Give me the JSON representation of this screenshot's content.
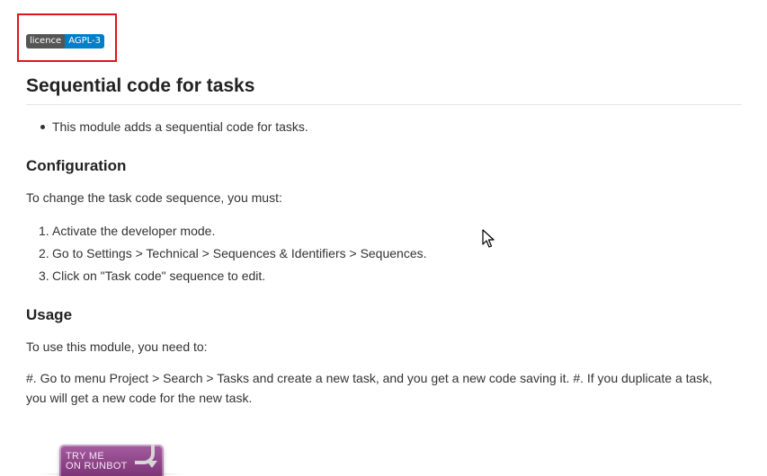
{
  "badge": {
    "left_label": "licence",
    "right_label": "AGPL-3",
    "left_color": "#555555",
    "right_color": "#007ec6"
  },
  "highlight_color": "#e0141c",
  "title": "Sequential code for tasks",
  "intro_bullets": [
    "This module adds a sequential code for tasks."
  ],
  "configuration": {
    "heading": "Configuration",
    "intro": "To change the task code sequence, you must:",
    "steps": [
      {
        "num": "1.",
        "text": "Activate the developer mode."
      },
      {
        "num": "2.",
        "text": "Go to Settings > Technical > Sequences & Identifiers > Sequences."
      },
      {
        "num": "3.",
        "text": "Click on \"Task code\" sequence to edit."
      }
    ]
  },
  "usage": {
    "heading": "Usage",
    "intro": "To use this module, you need to:",
    "body_line1": "#. Go to menu Project > Search > Tasks and create a new task, and you get a new code saving it. #. If you duplicate a task,",
    "body_line2": "you will get a new code for the new task."
  },
  "runbot_button": {
    "line1": "TRY ME",
    "line2": "ON RUNBOT",
    "icon": "curved-arrow-icon"
  },
  "cursor_icon": "mouse-pointer-icon"
}
